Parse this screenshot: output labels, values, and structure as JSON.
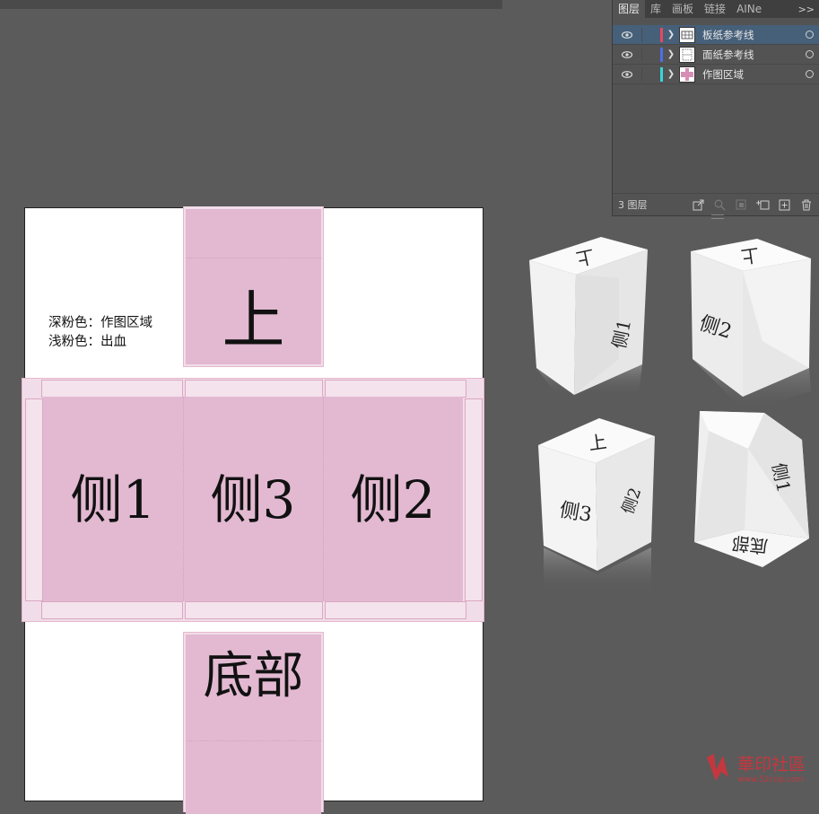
{
  "layers_panel": {
    "tabs": [
      {
        "label": "图层",
        "active": true
      },
      {
        "label": "库",
        "active": false
      },
      {
        "label": "画板",
        "active": false
      },
      {
        "label": "链接",
        "active": false
      },
      {
        "label": "AINe",
        "active": false
      }
    ],
    "more_label": ">>",
    "layers": [
      {
        "name": "板纸参考线",
        "color": "#e8485a",
        "selected": true
      },
      {
        "name": "面纸参考线",
        "color": "#4c6ee6",
        "selected": false
      },
      {
        "name": "作图区域",
        "color": "#38d6d6",
        "selected": false
      }
    ],
    "footer": {
      "count_text": "3 图层"
    }
  },
  "artboard": {
    "legend": {
      "line1": "深粉色：作图区域",
      "line2": "浅粉色：出血"
    },
    "faces": {
      "top": "上",
      "side1": "侧1",
      "side3": "侧3",
      "side2": "侧2",
      "bottom": "底部"
    },
    "colors": {
      "dark_pink": "#e2b9d1",
      "light_pink": "#f1dde9"
    }
  },
  "mockups": {
    "box_a": {
      "top": "上",
      "side": "侧1"
    },
    "box_b": {
      "top": "上",
      "side": "侧2"
    },
    "box_c": {
      "top": "上",
      "left": "侧3",
      "right": "侧2"
    },
    "box_d": {
      "side": "侧1",
      "bottom": "底部"
    }
  },
  "watermark": {
    "text": "華印社區",
    "url": "www.52cnp.com"
  }
}
